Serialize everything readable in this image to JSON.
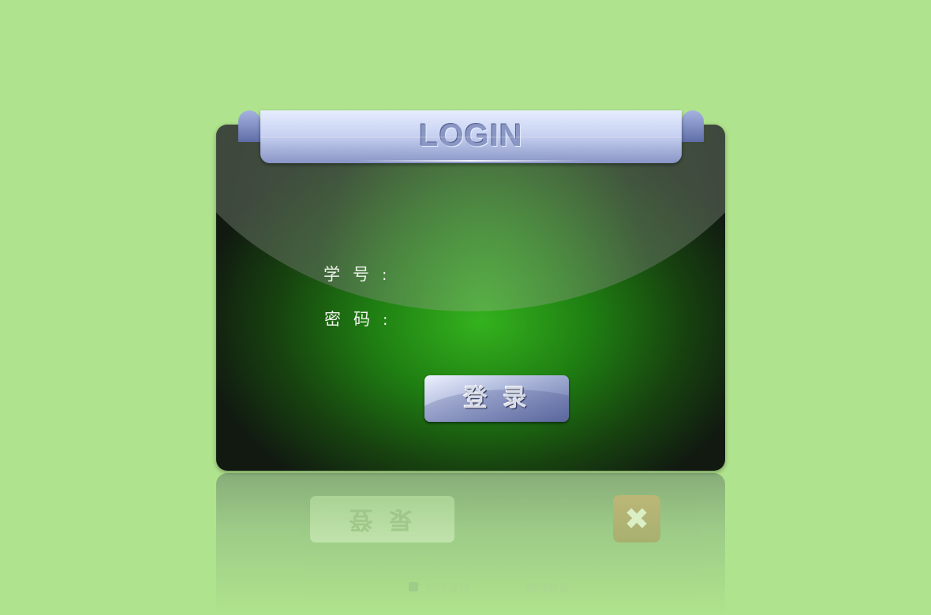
{
  "header": {
    "title": "LOGIN"
  },
  "form": {
    "student_id_label": "学号",
    "password_label": "密码",
    "colon": ":",
    "login_button": "登录"
  },
  "reflection": {
    "login_button": "登录",
    "close_glyph": "✖",
    "remember_text": "记住密码",
    "auto_text": "自动登录"
  },
  "colors": {
    "background": "#b0e38d",
    "panel_center": "#34b21e",
    "panel_edge": "#111911",
    "tab": "#c9d3f2"
  }
}
